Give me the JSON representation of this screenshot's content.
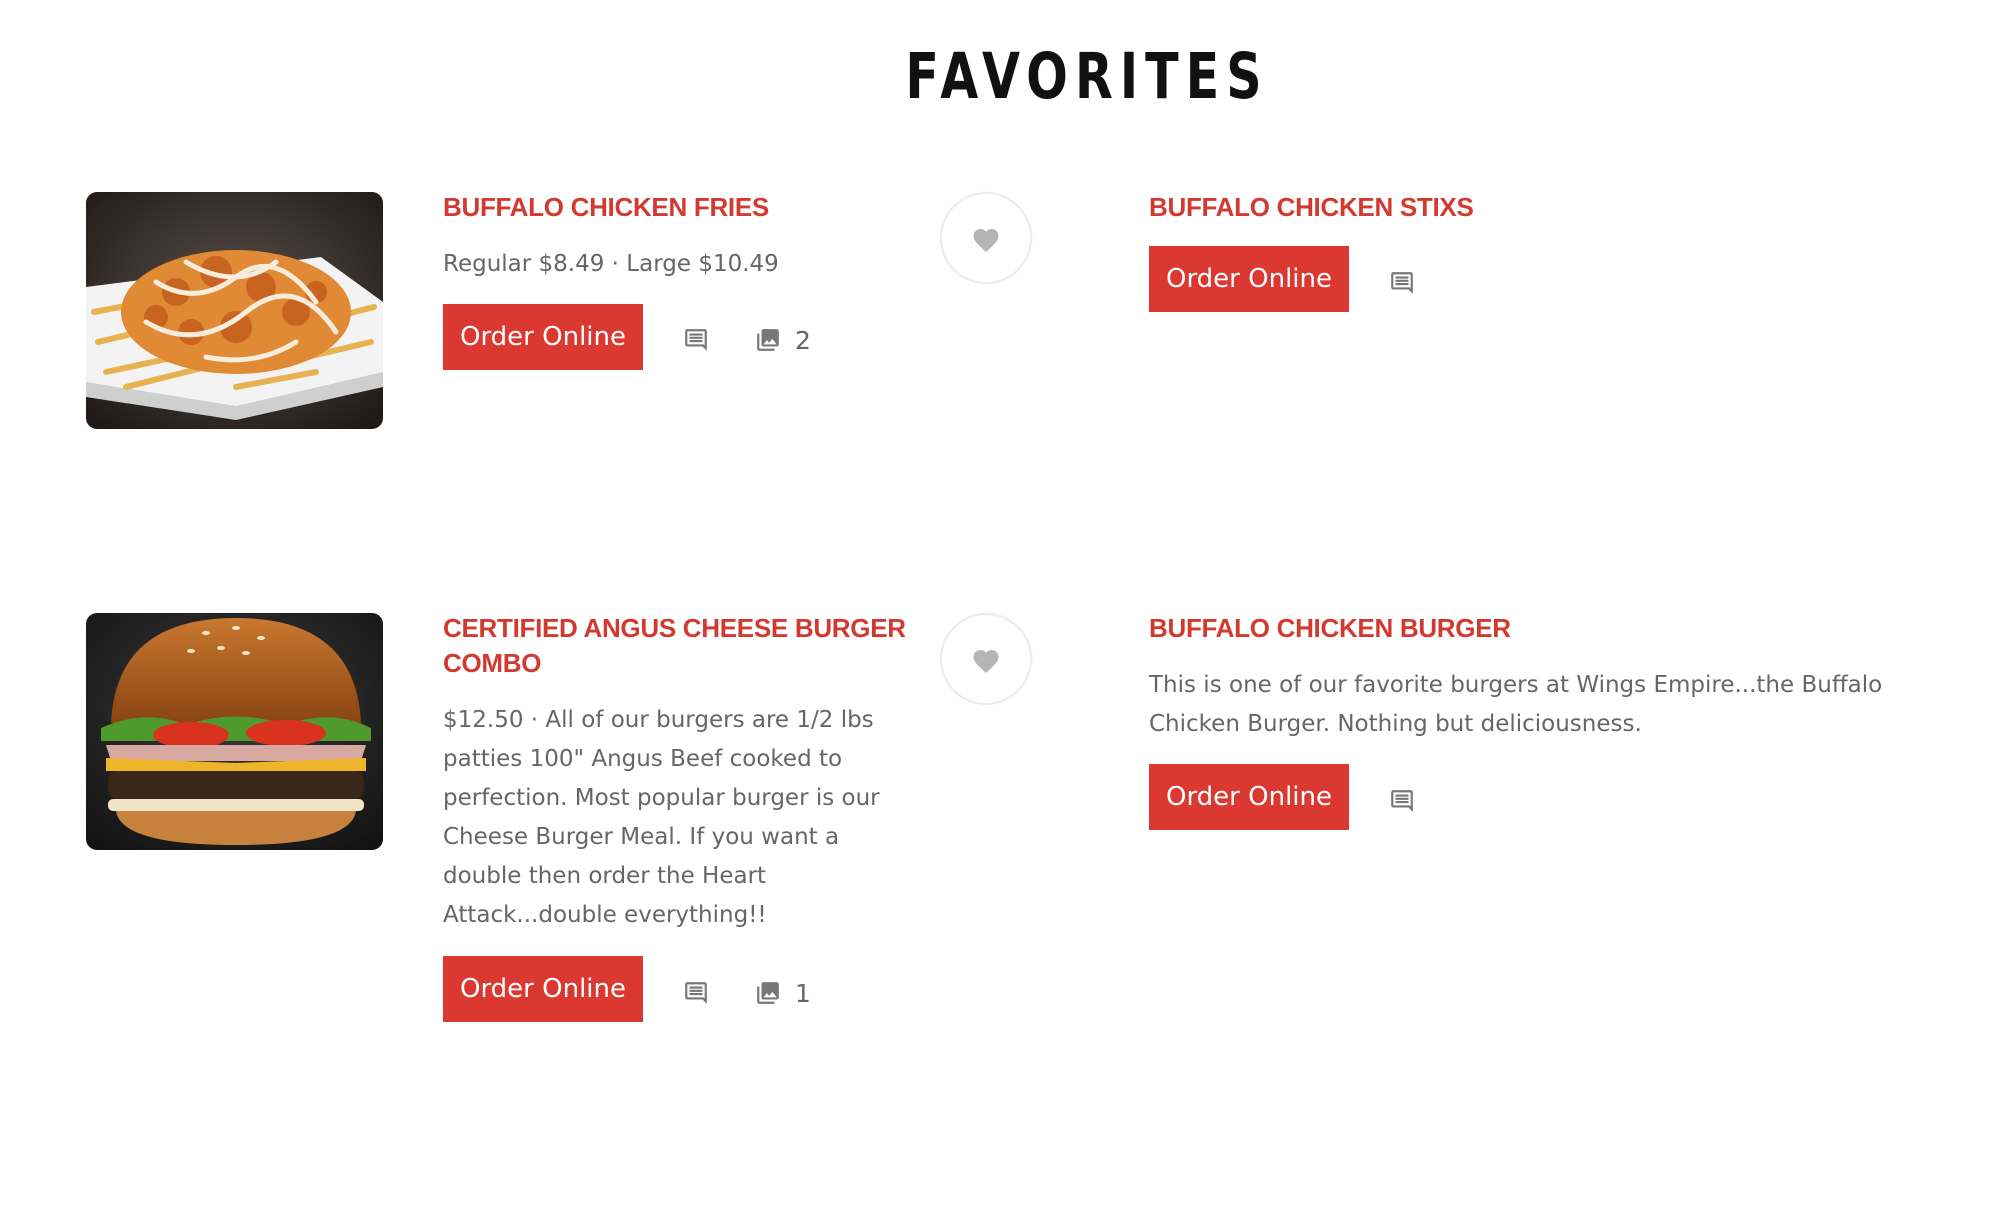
{
  "section": {
    "title": "FAVORITES"
  },
  "items": [
    {
      "name": "BUFFALO CHICKEN FRIES",
      "description": "Regular $8.49 · Large $10.49",
      "order_label": "Order Online",
      "photo_count": "2",
      "image_icon": "loaded-fries-photo"
    },
    {
      "name": "BUFFALO CHICKEN STIXS",
      "order_label": "Order Online"
    },
    {
      "name": "CERTIFIED ANGUS CHEESE BURGER COMBO",
      "description": "$12.50 · All of our burgers are 1/2 lbs patties 100\" Angus Beef cooked to perfection. Most popular burger is our Cheese Burger Meal. If you want a double then order the Heart Attack...double everything!!",
      "order_label": "Order Online",
      "photo_count": "1",
      "image_icon": "cheeseburger-photo"
    },
    {
      "name": "BUFFALO CHICKEN BURGER",
      "description": "This is one of our favorite burgers at Wings Empire...the Buffalo Chicken Burger. Nothing but deliciousness.",
      "order_label": "Order Online"
    }
  ],
  "icons": {
    "comment": "comment-icon",
    "photos": "photo-icon",
    "favorite": "heart-icon"
  },
  "colors": {
    "accent": "#dc3832",
    "title": "#111111",
    "text": "#666666",
    "icon": "#777777",
    "heart": "#b5b5b5"
  }
}
